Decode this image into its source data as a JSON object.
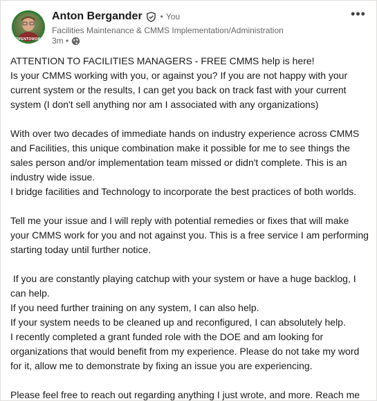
{
  "author": {
    "name": "Anton Bergander",
    "degree": "You",
    "separator": "•",
    "headline": "Facilities Maintenance & CMMS Implementation/Administration",
    "time": "3m •",
    "avatar_badge": "#OPENTOWORK",
    "verified_icon": "shield-check-icon",
    "visibility_icon": "globe-icon"
  },
  "menu": {
    "more_label": "•••"
  },
  "post": {
    "paragraphs": [
      [
        "ATTENTION TO FACILITIES MANAGERS - FREE CMMS help is here!",
        "Is your CMMS working with you, or against you? If you are not happy with your current system or the results, I can get you back on track fast with your current system (I don't sell anything nor am I associated with any organizations)"
      ],
      [
        "With over two decades of immediate hands on industry experience across CMMS and Facilities, this unique combination make it possible for me to see things the sales person and/or implementation team missed or didn't complete. This is an industry wide issue.",
        "I bridge facilities and Technology to incorporate the best practices of both worlds."
      ],
      [
        "Tell me your issue and I will reply with potential remedies or fixes that will make your CMMS work for you and not against you. This is a free service I am performing starting today until further notice."
      ],
      [
        " If you are constantly playing catchup with your system or have a huge backlog, I can help.",
        "If you need further training on any system, I can also help.",
        "If your system needs to be cleaned up and reconfigured, I can absolutely help.",
        "I recently completed a grant funded role with the DOE and am looking for organizations that would benefit from my experience. Please do not take my word for it, allow me to demonstrate by fixing an issue you are experiencing."
      ],
      [
        "Please feel free to reach out regarding anything I just wrote, and more. Reach me by scanning the QR below. I look forward to a conversation."
      ]
    ]
  }
}
